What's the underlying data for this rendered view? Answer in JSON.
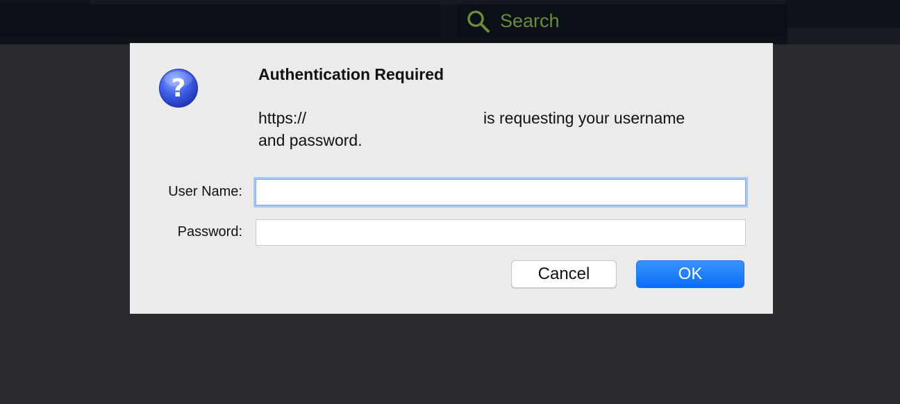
{
  "browser": {
    "search_placeholder": "Search"
  },
  "dialog": {
    "icon": "question-icon",
    "title": "Authentication Required",
    "message_prefix": "https://",
    "message_suffix": "is requesting your username",
    "message_line2": "and password.",
    "username_label": "User Name:",
    "username_value": "",
    "password_label": "Password:",
    "password_value": "",
    "cancel_label": "Cancel",
    "ok_label": "OK"
  },
  "colors": {
    "accent": "#0a6cf5",
    "dialog_background": "#ebebeb",
    "search_text": "#6f8a3a"
  }
}
